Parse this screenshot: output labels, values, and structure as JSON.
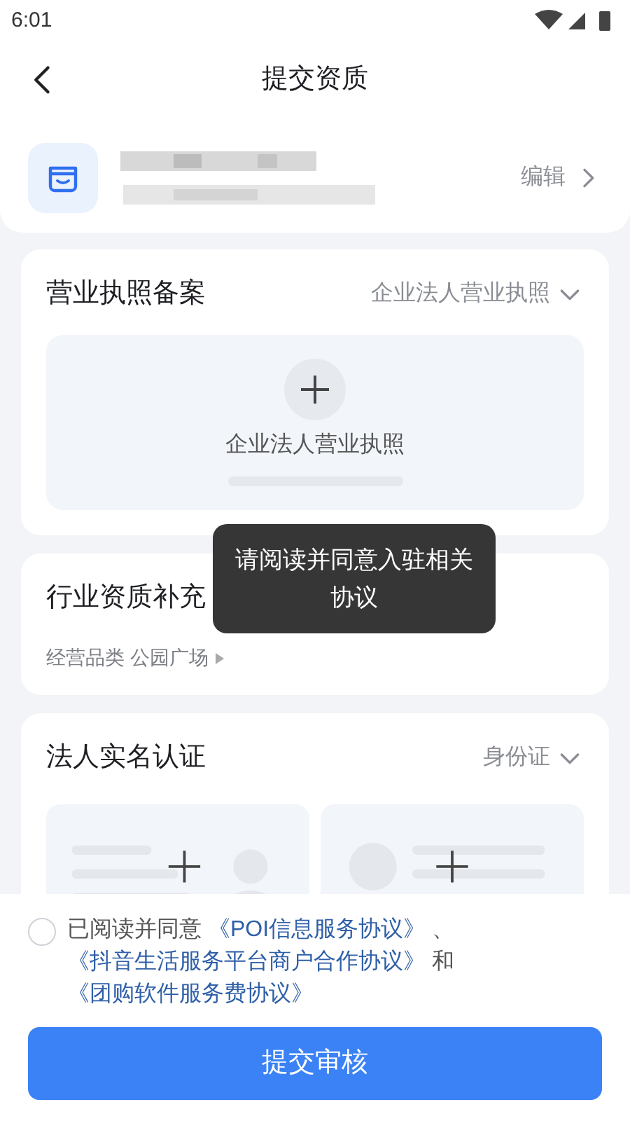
{
  "status_bar": {
    "time": "6:01"
  },
  "header": {
    "title": "提交资质"
  },
  "store": {
    "edit": "编辑"
  },
  "sections": [
    {
      "kind": "upload",
      "title": "营业执照备案",
      "selector": "企业法人营业执照",
      "upload_label": "企业法人营业执照"
    },
    {
      "kind": "info",
      "title": "行业资质补充",
      "category_label": "经营品类",
      "category_value": "公园广场"
    },
    {
      "kind": "id",
      "title": "法人实名认证",
      "selector": "身份证"
    }
  ],
  "agreement": {
    "checked": false,
    "parts": [
      {
        "kind": "text",
        "text": "已阅读并同意 "
      },
      {
        "kind": "link",
        "text": "《POI信息服务协议》"
      },
      {
        "kind": "text",
        "text": " 、 "
      },
      {
        "kind": "link",
        "text": "《抖音生活服务平台商户合作协议》"
      },
      {
        "kind": "text",
        "text": " 和 "
      },
      {
        "kind": "link",
        "text": "《团购软件服务费协议》"
      }
    ]
  },
  "submit": {
    "label": "提交审核"
  },
  "toast": {
    "message": "请阅读并同意入驻相关协议"
  }
}
